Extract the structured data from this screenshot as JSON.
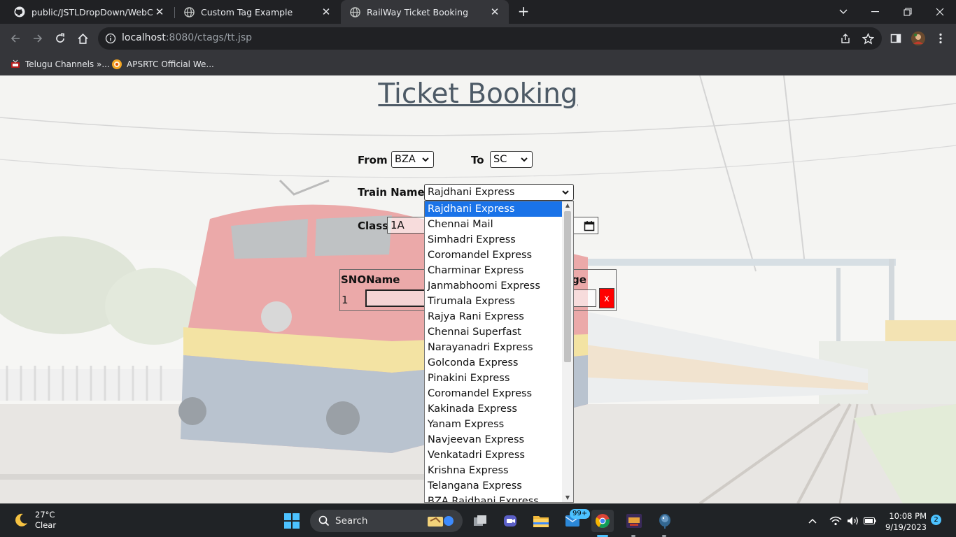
{
  "browser": {
    "tabs": [
      {
        "title": "public/JSTLDropDown/WebConte",
        "icon": "github-icon",
        "active": false
      },
      {
        "title": "Custom Tag Example",
        "icon": "globe-icon",
        "active": false
      },
      {
        "title": "RailWay Ticket Booking",
        "icon": "globe-icon",
        "active": true
      }
    ],
    "url_host": "localhost",
    "url_rest": ":8080/ctags/tt.jsp",
    "bookmarks": [
      {
        "label": "Telugu Channels »...",
        "icon": "tv-icon"
      },
      {
        "label": "APSRTC Official We...",
        "icon": "apsrtc-icon"
      }
    ]
  },
  "page": {
    "heading": "Ticket Booking",
    "from_label": "From",
    "from_value": "BZA",
    "to_label": "To",
    "to_value": "SC",
    "train_label": "Train Name",
    "train_value": "Rajdhani Express",
    "class_label": "Class",
    "class_value": "1A",
    "table_headers": {
      "sno": "SNO",
      "name": "Name",
      "age": "ge"
    },
    "row": {
      "sno": "1",
      "remove": "x"
    },
    "train_options": [
      "Rajdhani Express",
      "Chennai Mail",
      "Simhadri Express",
      "Coromandel Express",
      "Charminar Express",
      "Janmabhoomi Express",
      "Tirumala Express",
      "Rajya Rani Express",
      "Chennai Superfast",
      "Narayanadri Express",
      "Golconda Express",
      "Pinakini Express",
      "Coromandel Express",
      "Kakinada Express",
      "Yanam Express",
      "Navjeevan Express",
      "Venkatadri Express",
      "Krishna Express",
      "Telangana Express",
      "BZA Rajdhani Express"
    ],
    "selected_index": 0
  },
  "taskbar": {
    "temperature": "27°C",
    "condition": "Clear",
    "search_label": "Search",
    "mail_badge": "99+",
    "time": "10:08 PM",
    "date": "9/19/2023",
    "notifications": "2"
  },
  "colors": {
    "accent": "#1a73e8",
    "remove_button": "#ff0000",
    "heading": "#4d5a66"
  }
}
